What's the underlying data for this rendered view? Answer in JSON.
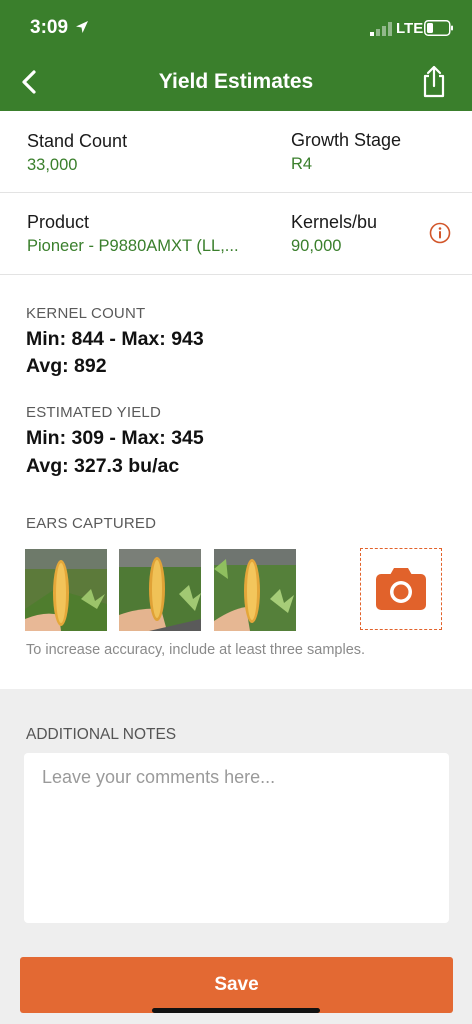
{
  "status_bar": {
    "time": "3:09",
    "network": "LTE"
  },
  "header": {
    "title": "Yield Estimates"
  },
  "info": {
    "stand_count": {
      "label": "Stand Count",
      "value": "33,000"
    },
    "growth_stage": {
      "label": "Growth Stage",
      "value": "R4"
    },
    "product": {
      "label": "Product",
      "value": "Pioneer - P9880AMXT (LL,..."
    },
    "kernels_bu": {
      "label": "Kernels/bu",
      "value": "90,000"
    }
  },
  "kernel_count": {
    "label": "KERNEL COUNT",
    "range": "Min: 844 - Max: 943",
    "avg": "Avg: 892"
  },
  "estimated_yield": {
    "label": "ESTIMATED YIELD",
    "range": "Min: 309 - Max: 345",
    "avg": "Avg: 327.3 bu/ac"
  },
  "ears": {
    "label": "EARS CAPTURED",
    "hint": "To increase accuracy, include at least three samples."
  },
  "notes": {
    "label": "ADDITIONAL NOTES",
    "placeholder": "Leave your comments here..."
  },
  "actions": {
    "save_label": "Save"
  },
  "colors": {
    "brand_green": "#3a7f2c",
    "accent_orange": "#e36933",
    "value_green": "#3a7f2c"
  }
}
